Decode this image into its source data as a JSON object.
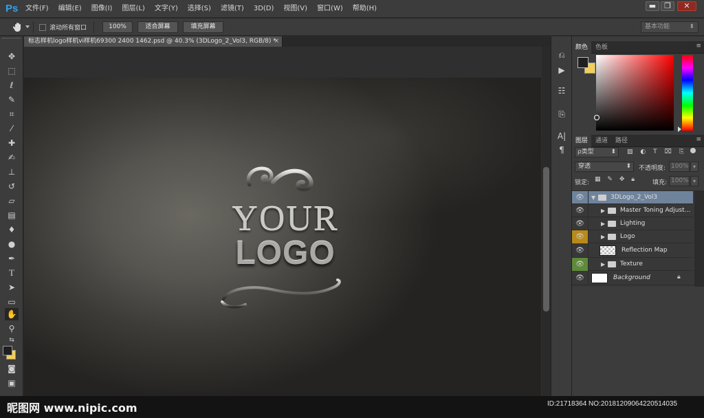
{
  "app": {
    "logo": "Ps",
    "accent": "#2fa3f0"
  },
  "menu": [
    "文件(F)",
    "编辑(E)",
    "图像(I)",
    "图层(L)",
    "文字(Y)",
    "选择(S)",
    "滤镜(T)",
    "3D(D)",
    "视图(V)",
    "窗口(W)",
    "帮助(H)"
  ],
  "window_controls": {
    "minimize": "▬",
    "restore": "❐",
    "close": "✕"
  },
  "options": {
    "tool_icon": "hand-icon",
    "scroll_all_label": "滚动所有窗口",
    "btn_100": "100%",
    "btn_fit": "适合屏幕",
    "btn_fill": "填充屏幕",
    "workspace": "基本功能"
  },
  "doc": {
    "tab_title": "标志样机logo样机vi样机69300 2400 1462.psd @ 40.3% (3DLogo_2_Vol3, RGB/8) *",
    "tab_close": "×",
    "logo_line1": "YOUR",
    "logo_line2": "LOGO"
  },
  "color_panel": {
    "tabs": [
      "颜色",
      "色板"
    ],
    "foreground": "#1f1f1f",
    "background": "#f2d057"
  },
  "layers_panel": {
    "tabs": [
      "图层",
      "通道",
      "路径"
    ],
    "filter_label": "ρ类型",
    "blend_mode": "穿透",
    "opacity_label": "不透明度:",
    "opacity_value": "100%",
    "lock_label": "锁定:",
    "fill_label": "填充:",
    "fill_value": "100%",
    "layers": [
      {
        "name": "3DLogo_2_Vol3",
        "kind": "group-open",
        "selected": true,
        "eye_color": ""
      },
      {
        "name": "Master Toning Adjust...",
        "kind": "group",
        "selected": false,
        "eye_color": ""
      },
      {
        "name": "Lighting",
        "kind": "group",
        "selected": false,
        "eye_color": ""
      },
      {
        "name": "Logo",
        "kind": "group",
        "selected": false,
        "eye_color": "#b88a1a"
      },
      {
        "name": "Reflection Map",
        "kind": "smart",
        "selected": false,
        "eye_color": ""
      },
      {
        "name": "Texture",
        "kind": "group",
        "selected": false,
        "eye_color": "#5e8a3a"
      },
      {
        "name": "Background",
        "kind": "background",
        "selected": false,
        "eye_color": ""
      }
    ]
  },
  "watermark": {
    "site": "昵图网 www.nipic.com",
    "id_text": "ID:21718364 NO:20181209064220514035"
  }
}
